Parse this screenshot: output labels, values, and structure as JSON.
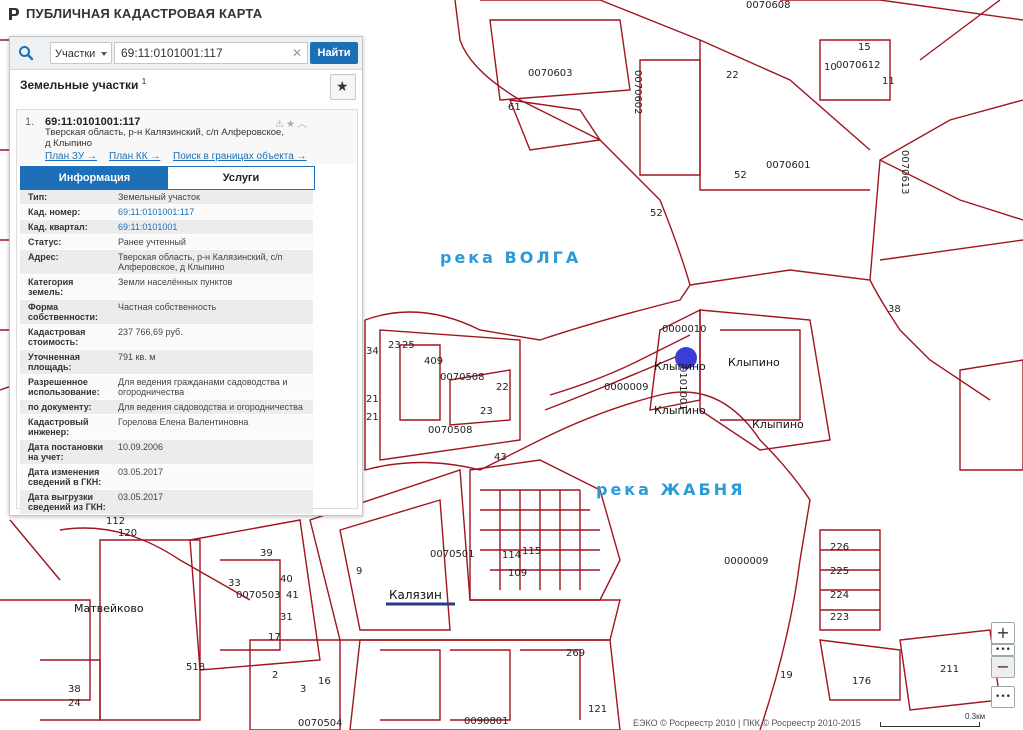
{
  "header": {
    "title": "ПУБЛИЧНАЯ КАДАСТРОВАЯ КАРТА"
  },
  "search": {
    "type_label": "Участки",
    "query": "69:11:0101001:117",
    "button": "Найти"
  },
  "results": {
    "title": "Земельные участки",
    "count": "1",
    "item": {
      "index": "1.",
      "cad_number": "69:11:0101001:117",
      "address": "Тверская область, р-н Калязинский, с/п Алферовское, д Клыпино",
      "links": [
        "План ЗУ →",
        "План КК →",
        "Поиск в границах объекта →"
      ]
    },
    "tabs": [
      "Информация",
      "Услуги"
    ],
    "properties": [
      {
        "label": "Тип:",
        "value": "Земельный участок"
      },
      {
        "label": "Кад. номер:",
        "value": "69:11:0101001:117",
        "link": true
      },
      {
        "label": "Кад. квартал:",
        "value": "69:11:0101001",
        "link": true
      },
      {
        "label": "Статус:",
        "value": "Ранее учтенный"
      },
      {
        "label": "Адрес:",
        "value": "Тверская область, р-н Калязинский, с/п Алферовское, д Клыпино"
      },
      {
        "label": "Категория земель:",
        "value": "Земли населённых пунктов"
      },
      {
        "label": "Форма собственности:",
        "value": "Частная собственность"
      },
      {
        "label": "Кадастровая стоимость:",
        "value": "237 766,69 руб."
      },
      {
        "label": "Уточненная площадь:",
        "value": "791 кв. м"
      },
      {
        "label": "Разрешенное использование:",
        "value": "Для ведения гражданами садоводства и огородничества"
      },
      {
        "label": "по документу:",
        "value": "Для ведения садоводства и огородничества"
      },
      {
        "label": "Кадастровый инженер:",
        "value": "Горелова Елена Валентиновна"
      },
      {
        "label": "Дата постановки на учет:",
        "value": "10.09.2006"
      },
      {
        "label": "Дата изменения сведений в ГКН:",
        "value": "03.05.2017"
      },
      {
        "label": "Дата выгрузки сведений из ГКН:",
        "value": "03.05.2017"
      }
    ]
  },
  "map": {
    "rivers": [
      "река ВОЛГА",
      "река ЖАБНЯ"
    ],
    "places": [
      "Клыпино",
      "Клыпино",
      "Клыпино",
      "Клыпино",
      "Калязин",
      "Матвейково"
    ],
    "quarters": [
      "0070603",
      "0070602",
      "0070601",
      "0070612",
      "0070613",
      "0070608",
      "0070508",
      "0070508",
      "0000010",
      "0000009",
      "0000009",
      "0070501",
      "0070503",
      "0070504",
      "0090801",
      "0101001"
    ],
    "parcels": [
      "61",
      "22",
      "52",
      "52",
      "15",
      "10",
      "11",
      "38",
      "34",
      "23",
      "25",
      "409",
      "22",
      "23",
      "21",
      "21",
      "43",
      "112",
      "120",
      "39",
      "33",
      "40",
      "41",
      "31",
      "17",
      "9",
      "114",
      "115",
      "109",
      "226",
      "225",
      "224",
      "223",
      "211",
      "176",
      "19",
      "518",
      "38",
      "24",
      "2",
      "3",
      "16",
      "269",
      "121"
    ],
    "credits": "ЕЭКО © Росреестр 2010 | ПКК © Росреестр 2010-2015",
    "scale": "0.3км",
    "zoom_in": "+",
    "zoom_out": "−",
    "more": "•••",
    "colors": {
      "boundary": "#a01520",
      "marker": "#3a3dd8",
      "river_label": "#2a9bd7",
      "accent": "#1d6fb8"
    }
  }
}
